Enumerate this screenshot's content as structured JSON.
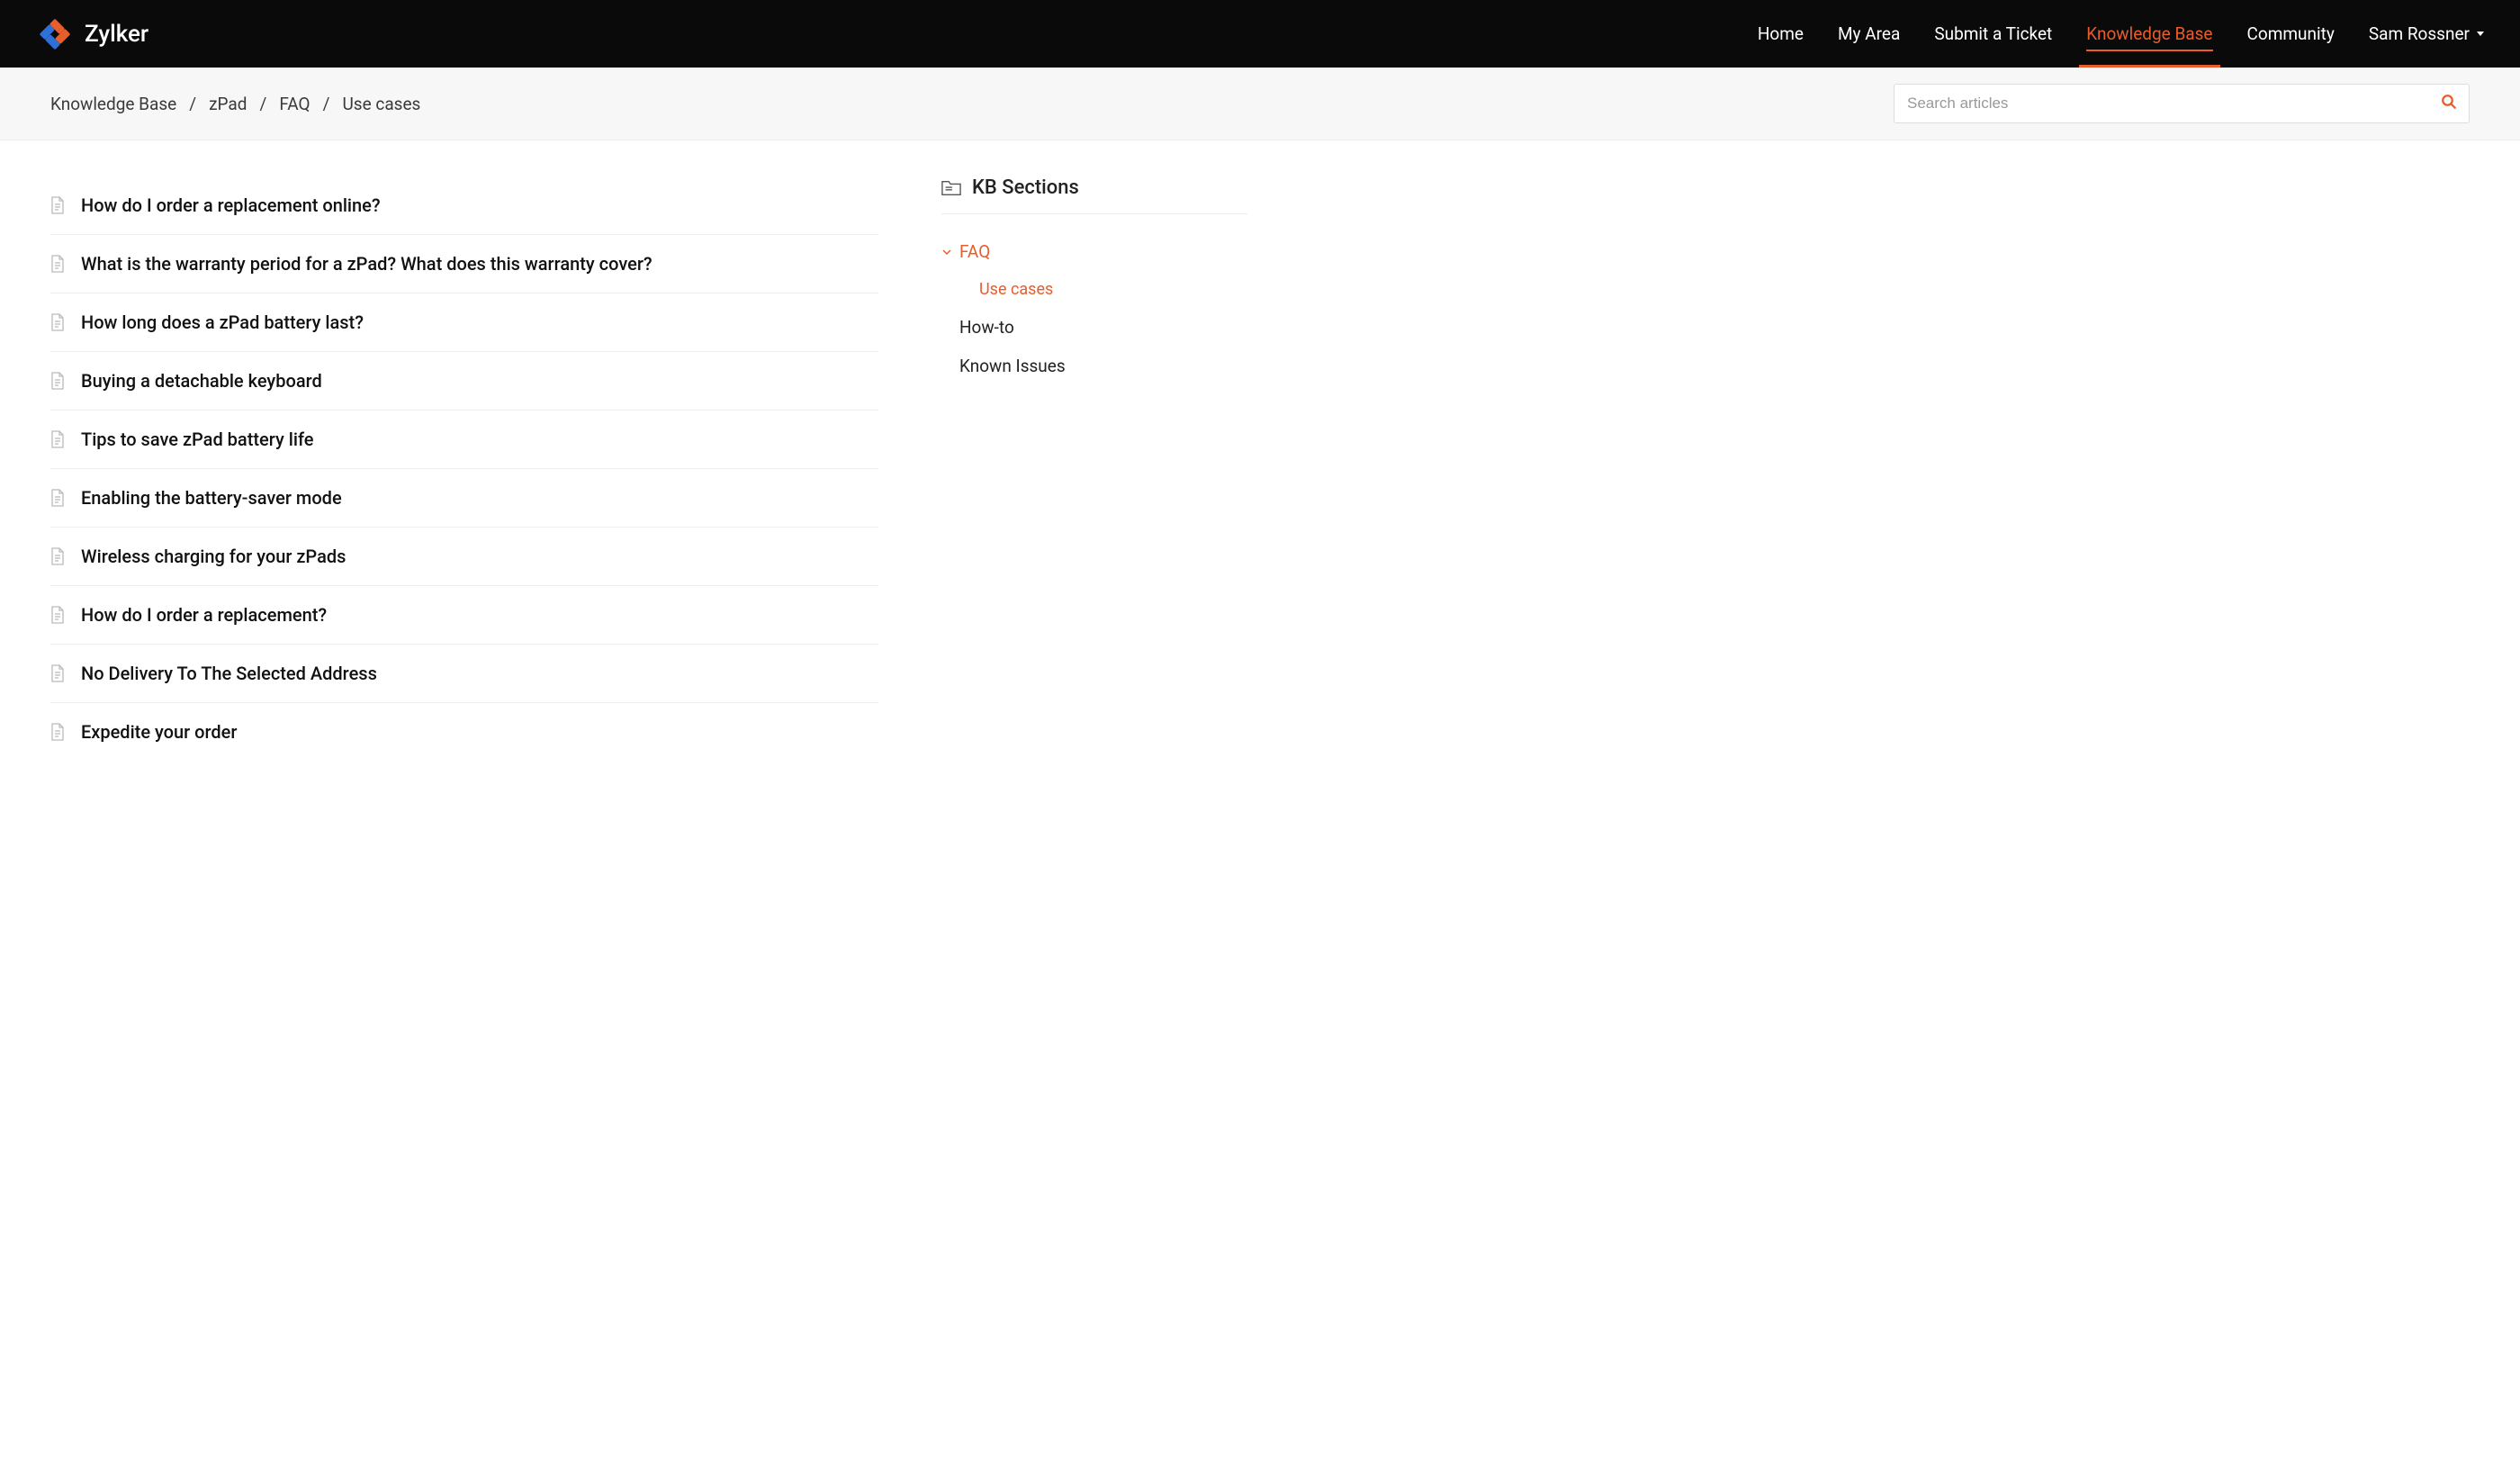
{
  "brand": {
    "name": "Zylker"
  },
  "nav": {
    "items": [
      {
        "label": "Home",
        "active": false
      },
      {
        "label": "My Area",
        "active": false
      },
      {
        "label": "Submit a Ticket",
        "active": false
      },
      {
        "label": "Knowledge Base",
        "active": true
      },
      {
        "label": "Community",
        "active": false
      }
    ],
    "user": "Sam Rossner"
  },
  "breadcrumb": {
    "items": [
      "Knowledge Base",
      "zPad",
      "FAQ",
      "Use cases"
    ]
  },
  "search": {
    "placeholder": "Search articles"
  },
  "articles": [
    "How do I order a replacement online?",
    "What is the warranty period for a zPad? What does this warranty cover?",
    "How long does a zPad battery last?",
    "Buying a detachable keyboard",
    "Tips to save zPad battery life",
    "Enabling the battery-saver mode",
    "Wireless charging for your zPads",
    "How do I order a replacement?",
    "No Delivery To The Selected Address",
    "Expedite your order"
  ],
  "sidebar": {
    "title": "KB Sections",
    "sections": {
      "faq": {
        "label": "FAQ",
        "active": true,
        "expanded": true
      },
      "usecases": {
        "label": "Use cases",
        "active": true
      },
      "howto": {
        "label": "How-to",
        "active": false
      },
      "known": {
        "label": "Known Issues",
        "active": false
      }
    }
  }
}
